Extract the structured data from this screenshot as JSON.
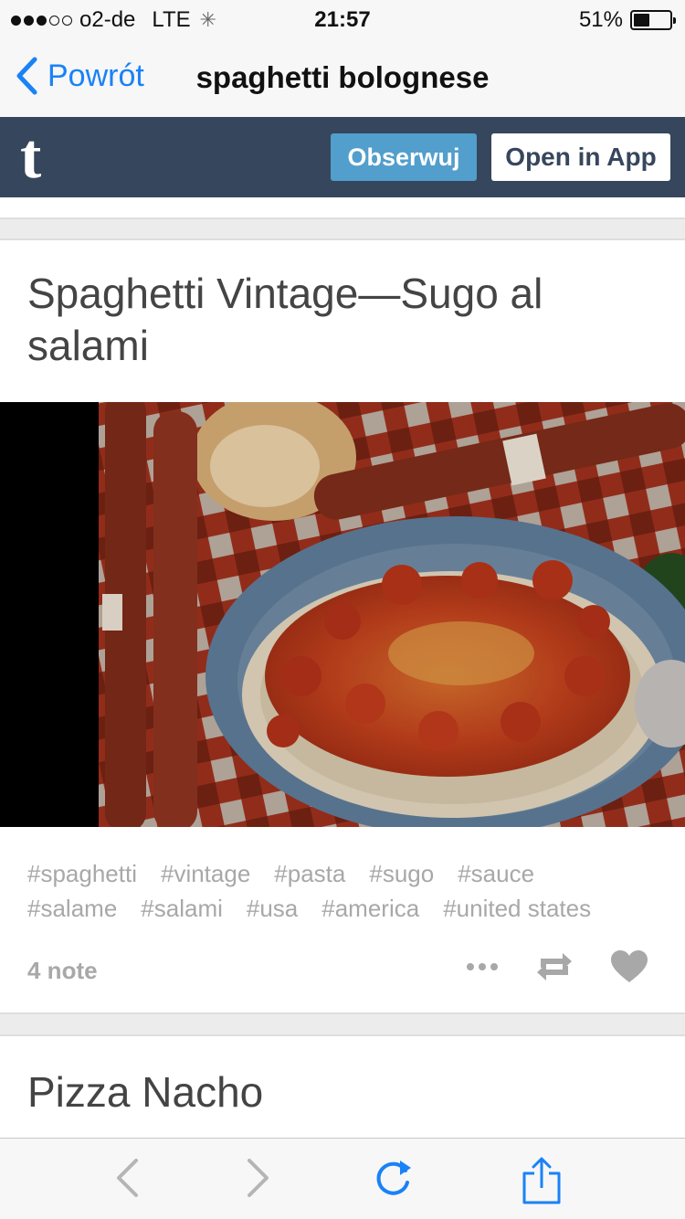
{
  "status_bar": {
    "carrier": "o2-de",
    "network": "LTE",
    "time": "21:57",
    "battery_percent": "51%",
    "battery_level": 0.51,
    "signal_bars_filled": 3
  },
  "nav": {
    "back_label": "Powrót",
    "title": "spaghetti bolognese"
  },
  "tumblr_header": {
    "logo_letter": "t",
    "follow_label": "Obserwuj",
    "open_app_label": "Open in App",
    "background_color": "#36465d",
    "follow_color": "#529ecc"
  },
  "post": {
    "title": "Spaghetti Vintage—Sugo al salami",
    "tags_row1": [
      "#spaghetti",
      "#vintage",
      "#pasta",
      "#sugo",
      "#sauce"
    ],
    "tags_row2": [
      "#salame",
      "#salami",
      "#usa",
      "#america",
      "#united states"
    ],
    "notes": "4 note"
  },
  "next_post": {
    "title": "Pizza Nacho"
  },
  "icons": {
    "back": "chevron-left-icon",
    "more": "more-icon",
    "reblog": "reblog-icon",
    "like": "heart-icon",
    "toolbar": [
      "back-arrow-icon",
      "forward-arrow-icon",
      "reload-icon",
      "share-icon"
    ]
  }
}
